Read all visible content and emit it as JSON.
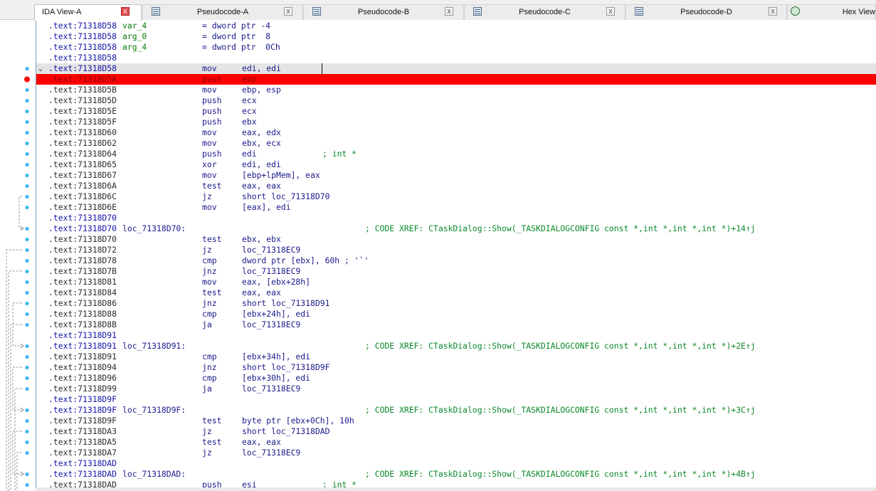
{
  "tabs": [
    {
      "label": "IDA View-A",
      "active": true,
      "close": "x"
    },
    {
      "label": "Pseudocode-A",
      "close": "x"
    },
    {
      "label": "Pseudocode-B",
      "close": "x"
    },
    {
      "label": "Pseudocode-C",
      "close": "x"
    },
    {
      "label": "Pseudocode-D",
      "close": "x"
    },
    {
      "label": "Hex View"
    }
  ],
  "lines": [
    {
      "addr": ".text:71318D58",
      "label": "var_4",
      "mnemonic": "= dword ptr -4"
    },
    {
      "addr": ".text:71318D58",
      "label": "arg_0",
      "mnemonic": "= dword ptr  8"
    },
    {
      "addr": ".text:71318D58",
      "label": "arg_4",
      "mnemonic": "= dword ptr  0Ch"
    },
    {
      "addr": ".text:71318D58"
    },
    {
      "addr": ".text:71318D58",
      "mnemonic": "mov",
      "operands": "edi, edi",
      "current": true
    },
    {
      "addr": ".text:71318D5A",
      "mnemonic": "push",
      "operands": "ebp",
      "breakpoint": true
    },
    {
      "addr": ".text:71318D5B",
      "mnemonic": "mov",
      "operands": "ebp, esp"
    },
    {
      "addr": ".text:71318D5D",
      "mnemonic": "push",
      "operands": "ecx"
    },
    {
      "addr": ".text:71318D5E",
      "mnemonic": "push",
      "operands": "ecx"
    },
    {
      "addr": ".text:71318D5F",
      "mnemonic": "push",
      "operands": "ebx"
    },
    {
      "addr": ".text:71318D60",
      "mnemonic": "mov",
      "operands": "eax, edx"
    },
    {
      "addr": ".text:71318D62",
      "mnemonic": "mov",
      "operands": "ebx, ecx"
    },
    {
      "addr": ".text:71318D64",
      "mnemonic": "push",
      "operands": "edi",
      "comment": "; int *"
    },
    {
      "addr": ".text:71318D65",
      "mnemonic": "xor",
      "operands": "edi, edi"
    },
    {
      "addr": ".text:71318D67",
      "mnemonic": "mov",
      "operands": "[ebp+lpMem], eax"
    },
    {
      "addr": ".text:71318D6A",
      "mnemonic": "test",
      "operands": "eax, eax"
    },
    {
      "addr": ".text:71318D6C",
      "mnemonic": "jz",
      "operands": "short loc_71318D70"
    },
    {
      "addr": ".text:71318D6E",
      "mnemonic": "mov",
      "operands": "[eax], edi"
    },
    {
      "addr": ".text:71318D70"
    },
    {
      "addr": ".text:71318D70",
      "label": "loc_71318D70:",
      "comment": "; CODE XREF: CTaskDialog::Show(_TASKDIALOGCONFIG const *,int *,int *,int *)+14↑j"
    },
    {
      "addr": ".text:71318D70",
      "mnemonic": "test",
      "operands": "ebx, ebx"
    },
    {
      "addr": ".text:71318D72",
      "mnemonic": "jz",
      "operands": "loc_71318EC9"
    },
    {
      "addr": ".text:71318D78",
      "mnemonic": "cmp",
      "operands": "dword ptr [ebx], 60h ; '`'"
    },
    {
      "addr": ".text:71318D7B",
      "mnemonic": "jnz",
      "operands": "loc_71318EC9"
    },
    {
      "addr": ".text:71318D81",
      "mnemonic": "mov",
      "operands": "eax, [ebx+28h]"
    },
    {
      "addr": ".text:71318D84",
      "mnemonic": "test",
      "operands": "eax, eax"
    },
    {
      "addr": ".text:71318D86",
      "mnemonic": "jnz",
      "operands": "short loc_71318D91"
    },
    {
      "addr": ".text:71318D88",
      "mnemonic": "cmp",
      "operands": "[ebx+24h], edi"
    },
    {
      "addr": ".text:71318D8B",
      "mnemonic": "ja",
      "operands": "loc_71318EC9"
    },
    {
      "addr": ".text:71318D91"
    },
    {
      "addr": ".text:71318D91",
      "label": "loc_71318D91:",
      "comment": "; CODE XREF: CTaskDialog::Show(_TASKDIALOGCONFIG const *,int *,int *,int *)+2E↑j"
    },
    {
      "addr": ".text:71318D91",
      "mnemonic": "cmp",
      "operands": "[ebx+34h], edi"
    },
    {
      "addr": ".text:71318D94",
      "mnemonic": "jnz",
      "operands": "short loc_71318D9F"
    },
    {
      "addr": ".text:71318D96",
      "mnemonic": "cmp",
      "operands": "[ebx+30h], edi"
    },
    {
      "addr": ".text:71318D99",
      "mnemonic": "ja",
      "operands": "loc_71318EC9"
    },
    {
      "addr": ".text:71318D9F"
    },
    {
      "addr": ".text:71318D9F",
      "label": "loc_71318D9F:",
      "comment": "; CODE XREF: CTaskDialog::Show(_TASKDIALOGCONFIG const *,int *,int *,int *)+3C↑j"
    },
    {
      "addr": ".text:71318D9F",
      "mnemonic": "test",
      "operands": "byte ptr [ebx+0Ch], 10h"
    },
    {
      "addr": ".text:71318DA3",
      "mnemonic": "jz",
      "operands": "short loc_71318DAD"
    },
    {
      "addr": ".text:71318DA5",
      "mnemonic": "test",
      "operands": "eax, eax"
    },
    {
      "addr": ".text:71318DA7",
      "mnemonic": "jz",
      "operands": "loc_71318EC9"
    },
    {
      "addr": ".text:71318DAD"
    },
    {
      "addr": ".text:71318DAD",
      "label": "loc_71318DAD:",
      "comment": "; CODE XREF: CTaskDialog::Show(_TASKDIALOGCONFIG const *,int *,int *,int *)+4B↑j"
    },
    {
      "addr": ".text:71318DAD",
      "mnemonic": "push",
      "operands": "esi",
      "comment": "; int *"
    }
  ],
  "colors": {
    "breakpoint": "#ff0000",
    "current_line": "#e4e4e4",
    "address": "#1414a8",
    "comment": "#0a8a2a",
    "gutter_dot": "#3fb8f0"
  }
}
